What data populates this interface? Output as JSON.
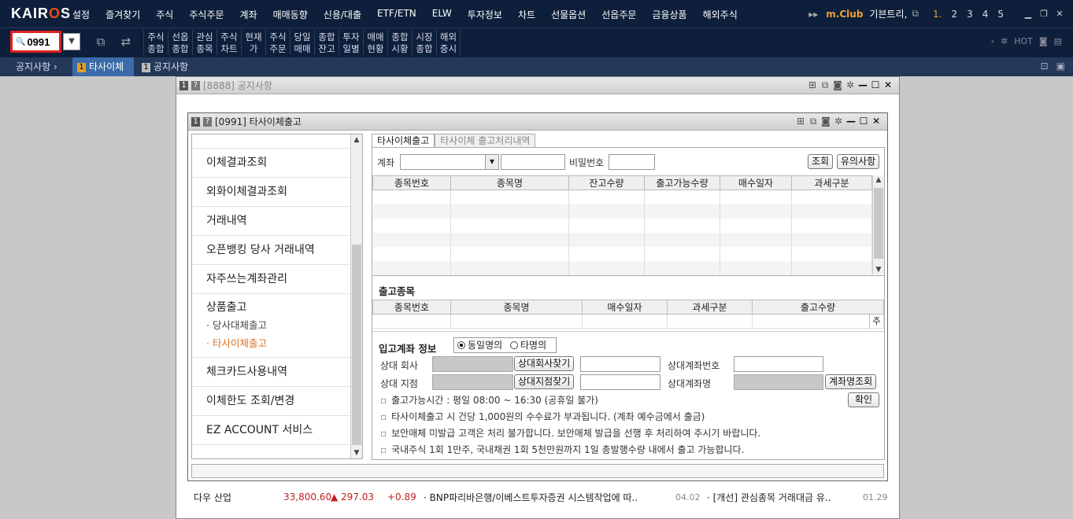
{
  "app": {
    "logo": "KAIROS"
  },
  "menu": [
    "설정",
    "즐겨찾기",
    "주식",
    "주식주문",
    "계좌",
    "매매동향",
    "신용/대출",
    "ETF/ETN",
    "ELW",
    "투자정보",
    "차트",
    "선물옵션",
    "선옵주문",
    "금융상품",
    "해외주식"
  ],
  "topright": {
    "mclub": "m.Club",
    "user": "기븐트리,",
    "nums": [
      "1.",
      "2",
      "3",
      "4",
      "5"
    ]
  },
  "search": {
    "value": "0991"
  },
  "tools": [
    "주식\n종합",
    "선옵\n종합",
    "관심\n종목",
    "주식\n차트",
    "현재\n가",
    "주식\n주문",
    "당일\n매매",
    "종합\n잔고",
    "투자\n일별",
    "매매\n현황",
    "종합\n시황",
    "시장\n종합",
    "해외\n증시"
  ],
  "tabs": {
    "breadcrumb": "공지사항 ›",
    "tab1": "타사이체",
    "tab2": "공지사항",
    "num1": "1",
    "num2": "1"
  },
  "backwin": {
    "title": "[8888] 공지사항",
    "badge1": "1",
    "badge2": "?"
  },
  "bottomrow": {
    "name": "다우 산업",
    "value": "33,800.60",
    "change": "▲ 297.03",
    "rate": "+0.89",
    "news1": "· BNP파리바은행/이베스트투자증권 시스템작업에 따..",
    "date1": "04.02",
    "news2": "· [개선] 관심종목 거래대금 유..",
    "date2": "01.29"
  },
  "frontwin": {
    "title": "[0991] 타사이체출고",
    "badge1": "1",
    "badge2": "?"
  },
  "nav": {
    "items": [
      "이체결과조회",
      "외화이체결과조회",
      "거래내역",
      "오픈뱅킹 당사 거래내역",
      "자주쓰는계좌관리"
    ],
    "group": "상품출고",
    "subs": [
      "· 당사대체출고",
      "· 타사이체출고"
    ],
    "items2": [
      "체크카드사용내역",
      "이체한도 조회/변경",
      "EZ ACCOUNT 서비스"
    ]
  },
  "rtabs": [
    "타사이체출고",
    "타사이체 출고처리내역"
  ],
  "form": {
    "account_label": "계좌",
    "pw_label": "비밀번호",
    "inquiry": "조회",
    "notice": "유의사항"
  },
  "grid1": {
    "headers": [
      "종목번호",
      "종목명",
      "잔고수량",
      "출고가능수량",
      "매수일자",
      "과세구분"
    ]
  },
  "out": {
    "title": "출고종목",
    "headers": [
      "종목번호",
      "종목명",
      "매수일자",
      "과세구분",
      "출고수량"
    ],
    "tail": "주"
  },
  "inacct": {
    "title": "입고계좌 정보",
    "radio1": "동일명의",
    "radio2": "타명의",
    "company_label": "상대 회사",
    "company_btn": "상대회사찾기",
    "acctno_label": "상대계좌번호",
    "branch_label": "상대 지점",
    "branch_btn": "상대지점찾기",
    "acctname_label": "상대계좌명",
    "acctname_btn": "계좌명조회",
    "confirm": "확인"
  },
  "notes": [
    "출고가능시간 : 평일 08:00 ~ 16:30 (공휴일 불가)",
    "타사이체출고 시 건당 1,000원의 수수료가 부과됩니다. (계좌 예수금에서 출금)",
    "보안매체 미발급 고객은 처리 불가합니다. 보안매체 발급을 선행 후 처리하여 주시기 바랍니다.",
    "국내주식 1회 1만주, 국내채권 1회 5천만원까지 1일 총발행수량 내에서 출고 가능합니다."
  ]
}
